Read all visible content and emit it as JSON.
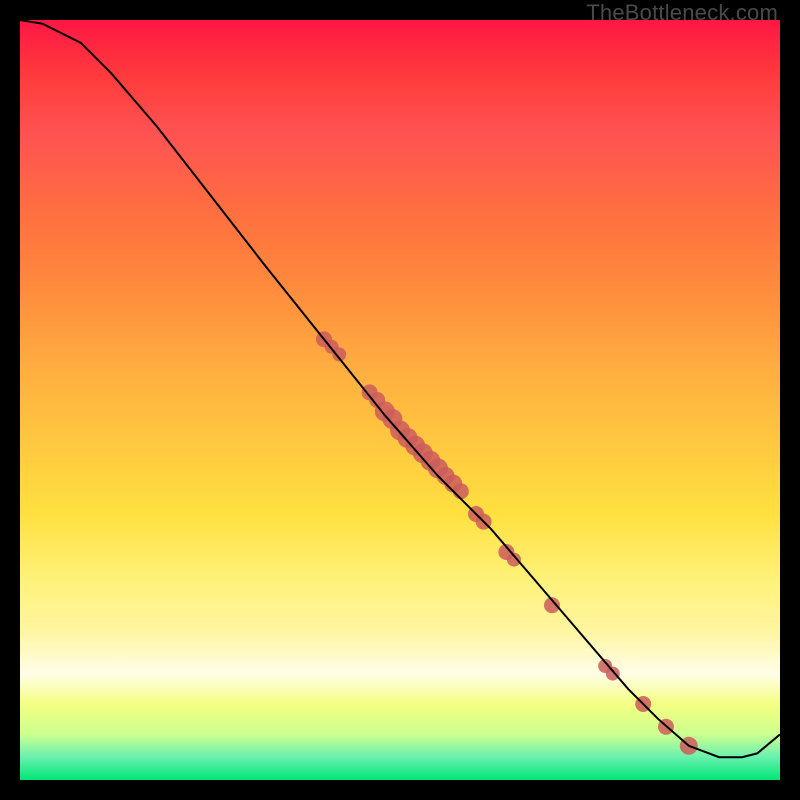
{
  "watermark": "TheBottleneck.com",
  "chart_data": {
    "type": "line",
    "title": "",
    "xlabel": "",
    "ylabel": "",
    "xlim": [
      0,
      100
    ],
    "ylim": [
      0,
      100
    ],
    "note": "Axes are unlabeled; values are pixel-proportional estimates on a 0–100 normalized scale. Curve descends from top-left, flattens near bottom, then rises slightly at far right. Background gradient encodes a secondary scale (red high → green low).",
    "curve": {
      "name": "main",
      "stroke": "#000000",
      "x": [
        0,
        3,
        8,
        12,
        18,
        25,
        32,
        40,
        48,
        55,
        62,
        68,
        74,
        80,
        84,
        88,
        92,
        95,
        97,
        100
      ],
      "y": [
        100,
        99.5,
        97,
        93,
        86,
        77,
        68,
        58,
        48,
        40,
        33,
        26,
        19,
        12,
        8,
        4.5,
        3,
        3,
        3.5,
        6
      ]
    },
    "points": {
      "name": "markers",
      "fill": "#cd5c5c",
      "x": [
        40,
        41,
        42,
        46,
        47,
        48,
        49,
        50,
        51,
        52,
        53,
        54,
        55,
        56,
        57,
        58,
        60,
        61,
        64,
        65,
        70,
        77,
        78,
        82,
        85,
        88
      ],
      "y": [
        58,
        57,
        56,
        51,
        50,
        48.5,
        47.5,
        46,
        45,
        44,
        43,
        42,
        41,
        40,
        39,
        38,
        35,
        34,
        30,
        29,
        23,
        15,
        14,
        10,
        7,
        4.5
      ],
      "r": [
        8,
        7,
        7,
        8,
        8,
        10,
        10,
        10,
        10,
        10,
        10,
        10,
        10,
        9,
        9,
        8,
        8,
        8,
        8,
        7,
        8,
        7,
        7,
        8,
        8,
        9
      ]
    }
  }
}
